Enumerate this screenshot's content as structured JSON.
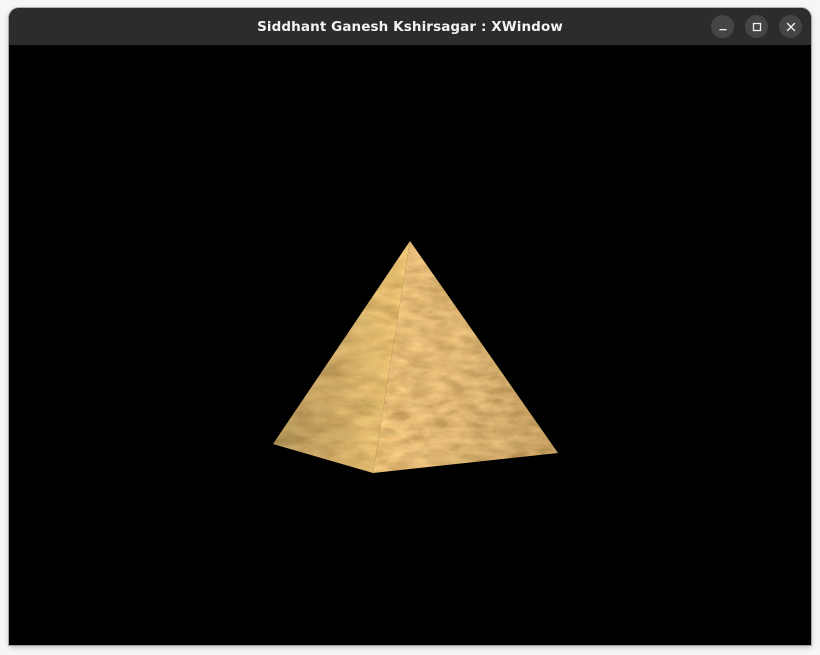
{
  "window": {
    "title": "Siddhant Ganesh Kshirsagar : XWindow",
    "controls": [
      "minimize-icon",
      "maximize-icon",
      "close-icon"
    ],
    "background_color": "#000000",
    "titlebar_color": "#2c2c2c"
  },
  "scene": {
    "object": "pyramid",
    "texture": "marble",
    "texture_colors": [
      "#c98a3e",
      "#e0b56a",
      "#8a5a2a",
      "#f0d090"
    ]
  }
}
